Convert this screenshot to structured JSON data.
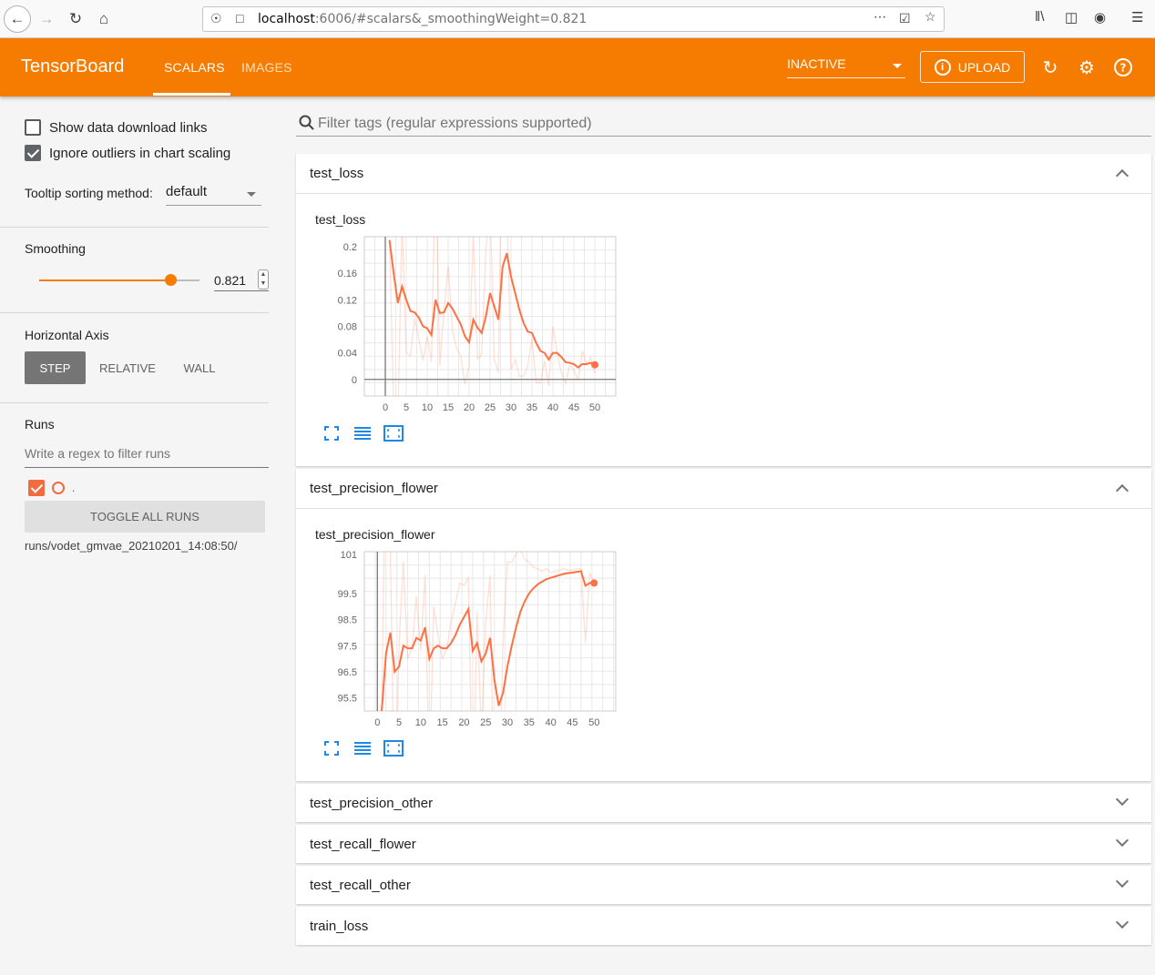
{
  "browser": {
    "url_host": "localhost",
    "url_rest": ":6006/#scalars&_smoothingWeight=0.821"
  },
  "header": {
    "brand": "TensorBoard",
    "tabs": [
      "SCALARS",
      "IMAGES"
    ],
    "run_status": "INACTIVE",
    "upload_label": "UPLOAD",
    "accent": "#f57c00"
  },
  "sidebar": {
    "show_download_label": "Show data download links",
    "ignore_outliers_label": "Ignore outliers in chart scaling",
    "tooltip_label": "Tooltip sorting method:",
    "tooltip_value": "default",
    "smoothing_label": "Smoothing",
    "smoothing_value": "0.821",
    "smoothing_fraction": 0.821,
    "horizontal_axis_label": "Horizontal Axis",
    "axis_options": [
      "STEP",
      "RELATIVE",
      "WALL"
    ],
    "runs_label": "Runs",
    "runs_filter_placeholder": "Write a regex to filter runs",
    "run_name": ".",
    "toggle_all_label": "TOGGLE ALL RUNS",
    "run_path": "runs/vodet_gmvae_20210201_14:08:50/"
  },
  "main": {
    "filter_placeholder": "Filter tags (regular expressions supported)",
    "cards": [
      {
        "title": "test_loss",
        "expanded": true
      },
      {
        "title": "test_precision_flower",
        "expanded": true
      },
      {
        "title": "test_precision_other",
        "expanded": false
      },
      {
        "title": "test_recall_flower",
        "expanded": false
      },
      {
        "title": "test_recall_other",
        "expanded": false
      },
      {
        "title": "train_loss",
        "expanded": false
      }
    ]
  },
  "chart_data": [
    {
      "type": "line",
      "title": "test_loss",
      "x_ticks": [
        "0",
        "5",
        "10",
        "15",
        "20",
        "25",
        "30",
        "35",
        "40",
        "45",
        "50"
      ],
      "y_ticks": [
        "0",
        "0.04",
        "0.08",
        "0.12",
        "0.16",
        "0.2"
      ],
      "xlim": [
        -5,
        55
      ],
      "ylim": [
        -0.025,
        0.215
      ],
      "series": [
        {
          "color": "#ff7043",
          "x": [
            1,
            2,
            3,
            4,
            5,
            6,
            7,
            8,
            9,
            10,
            11,
            12,
            13,
            14,
            15,
            16,
            17,
            18,
            19,
            20,
            21,
            22,
            23,
            24,
            25,
            26,
            27,
            28,
            29,
            30,
            31,
            32,
            33,
            34,
            35,
            36,
            37,
            38,
            39,
            40,
            41,
            42,
            43,
            44,
            45,
            46,
            47,
            48,
            49,
            50
          ],
          "y": [
            0.21,
            0.16,
            0.115,
            0.14,
            0.12,
            0.103,
            0.101,
            0.093,
            0.08,
            0.077,
            0.067,
            0.12,
            0.1,
            0.101,
            0.115,
            0.107,
            0.095,
            0.083,
            0.065,
            0.056,
            0.09,
            0.078,
            0.07,
            0.095,
            0.13,
            0.11,
            0.09,
            0.17,
            0.19,
            0.155,
            0.13,
            0.105,
            0.085,
            0.072,
            0.07,
            0.055,
            0.043,
            0.04,
            0.03,
            0.04,
            0.04,
            0.034,
            0.026,
            0.025,
            0.023,
            0.018,
            0.023,
            0.023,
            0.025,
            0.022
          ]
        }
      ]
    },
    {
      "type": "line",
      "title": "test_precision_flower",
      "x_ticks": [
        "0",
        "5",
        "10",
        "15",
        "20",
        "25",
        "30",
        "35",
        "40",
        "45",
        "50"
      ],
      "y_ticks": [
        "95.5",
        "96.5",
        "97.5",
        "98.5",
        "99.5",
        "101"
      ],
      "xlim": [
        -3,
        55
      ],
      "ylim": [
        95.0,
        101.1
      ],
      "series": [
        {
          "color": "#ff7043",
          "x": [
            1,
            2,
            3,
            4,
            5,
            6,
            7,
            8,
            9,
            10,
            11,
            12,
            13,
            14,
            15,
            16,
            17,
            18,
            19,
            20,
            21,
            22,
            23,
            24,
            25,
            26,
            27,
            28,
            29,
            30,
            31,
            32,
            33,
            34,
            35,
            36,
            37,
            38,
            39,
            40,
            41,
            42,
            43,
            44,
            45,
            46,
            47,
            48,
            49,
            50
          ],
          "y": [
            95.0,
            97.2,
            98.0,
            96.5,
            96.7,
            97.5,
            97.4,
            97.4,
            97.8,
            97.7,
            98.2,
            97.0,
            97.4,
            97.5,
            97.4,
            97.4,
            97.6,
            97.9,
            98.3,
            98.6,
            98.9,
            97.3,
            97.6,
            96.9,
            97.2,
            97.8,
            96.2,
            95.2,
            95.7,
            96.7,
            97.5,
            98.2,
            98.8,
            99.2,
            99.5,
            99.7,
            99.85,
            99.95,
            100.05,
            100.1,
            100.15,
            100.2,
            100.25,
            100.28,
            100.3,
            100.33,
            100.35,
            99.8,
            99.9,
            99.9
          ]
        }
      ]
    }
  ]
}
